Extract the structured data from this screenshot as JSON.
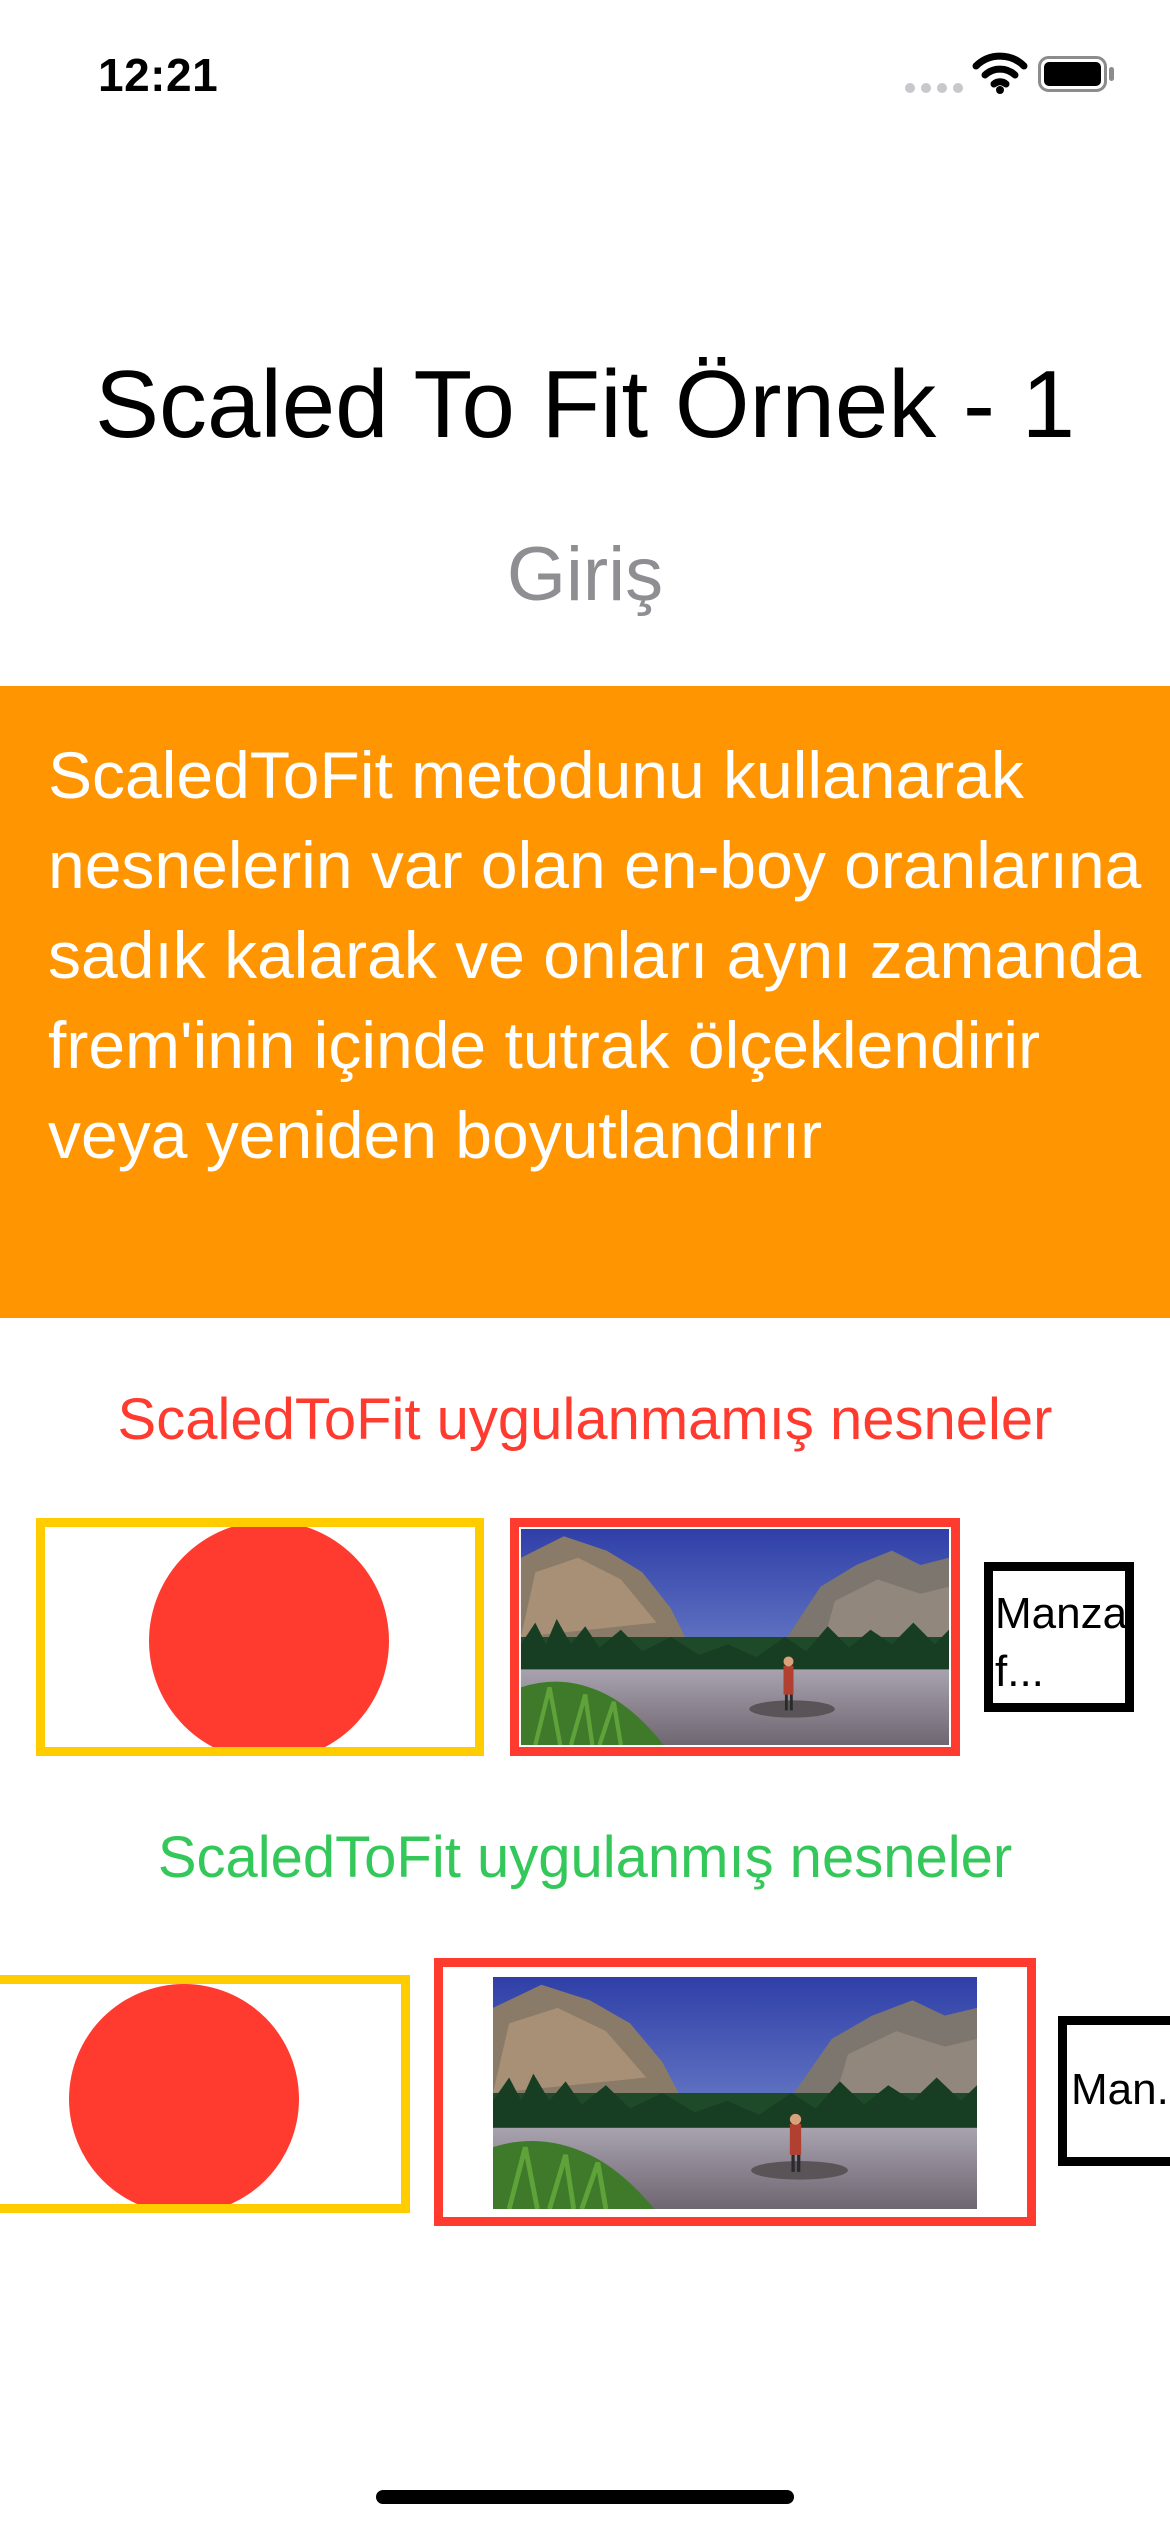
{
  "status_bar": {
    "time": "12:21"
  },
  "header": {
    "title": "Scaled To Fit Örnek - 1",
    "subtitle": "Giriş"
  },
  "intro": {
    "text": "ScaledToFit metodunu kullanarak nesnelerin var olan en-boy oranlarına sadık kalarak ve onları aynı zamanda frem'inin içinde tutrak ölçeklendirir veya yeniden boyutlandırır"
  },
  "sections": {
    "not_applied": {
      "heading": "ScaledToFit uygulanmamış nesneler",
      "text_box_label": "Manzara f..."
    },
    "applied": {
      "heading": "ScaledToFit uygulanmış nesneler",
      "text_box_label": "Man..."
    }
  },
  "colors": {
    "orange": "#ff9500",
    "red": "#ff3b30",
    "green": "#34c759",
    "yellow": "#ffcc00",
    "gray": "#8e8e93"
  },
  "icons": [
    "signal-dots-icon",
    "wifi-icon",
    "battery-icon",
    "circle-shape",
    "landscape-photo"
  ]
}
